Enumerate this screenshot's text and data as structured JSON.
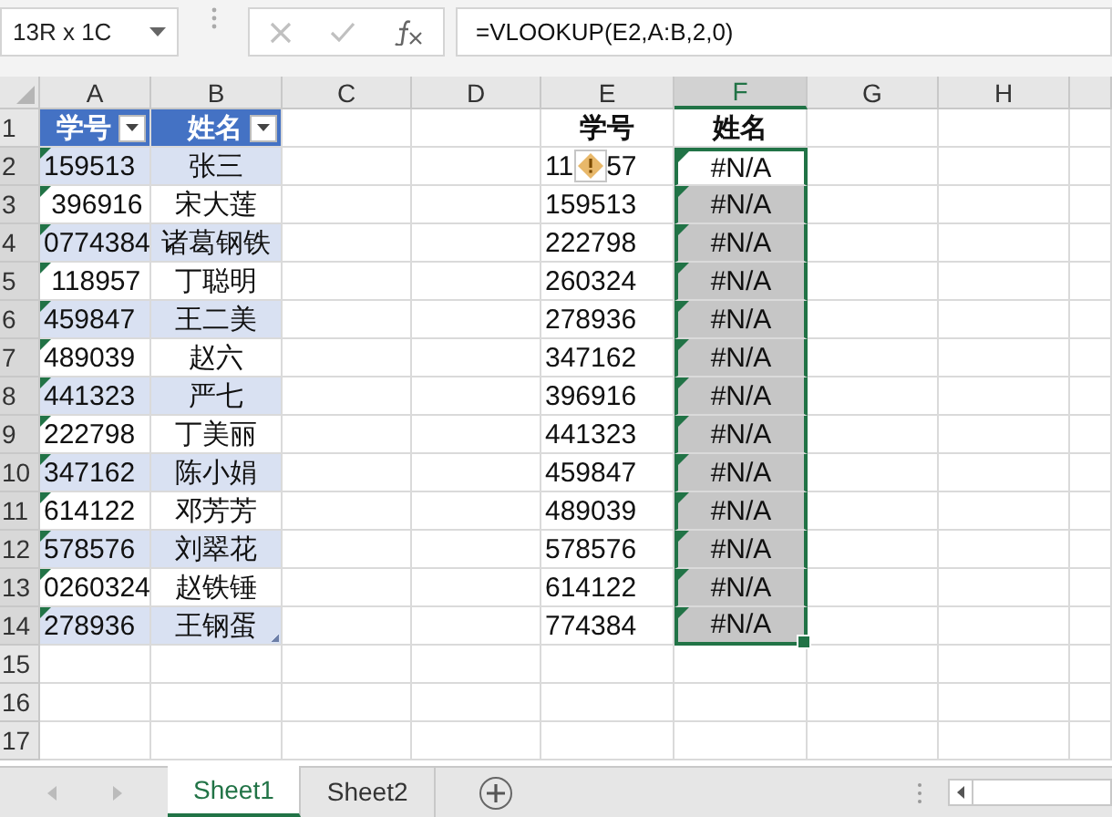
{
  "name_box": "13R x 1C",
  "formula": "=VLOOKUP(E2,A:B,2,0)",
  "columns": [
    {
      "label": "A",
      "selected": false
    },
    {
      "label": "B",
      "selected": false
    },
    {
      "label": "C",
      "selected": false
    },
    {
      "label": "D",
      "selected": false
    },
    {
      "label": "E",
      "selected": false
    },
    {
      "label": "F",
      "selected": true
    },
    {
      "label": "G",
      "selected": false
    },
    {
      "label": "H",
      "selected": false
    }
  ],
  "rows": [
    {
      "number": "1",
      "selected": false,
      "a": {
        "text": "学号",
        "kind": "header",
        "filter": true
      },
      "b": {
        "text": "姓名",
        "kind": "header",
        "filter": true
      },
      "e": {
        "text": "学号",
        "kind": "bold"
      },
      "f": {
        "text": "姓名",
        "kind": "bold"
      }
    },
    {
      "number": "2",
      "selected": true,
      "a": {
        "text": "159513",
        "kind": "band",
        "flag": true
      },
      "b": {
        "text": "张三",
        "kind": "band"
      },
      "e": {
        "text": "11",
        "tail": "57",
        "kind": "plain",
        "warning": true
      },
      "f": {
        "text": "#N/A",
        "kind": "active",
        "flag": true
      }
    },
    {
      "number": "3",
      "selected": true,
      "a": {
        "text": " 396916",
        "kind": "plain",
        "flag": true
      },
      "b": {
        "text": "宋大莲",
        "kind": "plain"
      },
      "e": {
        "text": "159513",
        "kind": "plain"
      },
      "f": {
        "text": "#N/A",
        "kind": "selected",
        "flag": true
      }
    },
    {
      "number": "4",
      "selected": true,
      "a": {
        "text": "0774384",
        "kind": "band",
        "flag": true
      },
      "b": {
        "text": "诸葛钢铁",
        "kind": "band"
      },
      "e": {
        "text": "222798",
        "kind": "plain"
      },
      "f": {
        "text": "#N/A",
        "kind": "selected",
        "flag": true
      }
    },
    {
      "number": "5",
      "selected": true,
      "a": {
        "text": " 118957",
        "kind": "plain",
        "flag": true
      },
      "b": {
        "text": "丁聪明",
        "kind": "plain"
      },
      "e": {
        "text": "260324",
        "kind": "plain"
      },
      "f": {
        "text": "#N/A",
        "kind": "selected",
        "flag": true
      }
    },
    {
      "number": "6",
      "selected": true,
      "a": {
        "text": "459847",
        "kind": "band",
        "flag": true
      },
      "b": {
        "text": "王二美",
        "kind": "band"
      },
      "e": {
        "text": "278936",
        "kind": "plain"
      },
      "f": {
        "text": "#N/A",
        "kind": "selected",
        "flag": true
      }
    },
    {
      "number": "7",
      "selected": true,
      "a": {
        "text": "489039",
        "kind": "plain",
        "flag": true
      },
      "b": {
        "text": "赵六",
        "kind": "plain"
      },
      "e": {
        "text": "347162",
        "kind": "plain"
      },
      "f": {
        "text": "#N/A",
        "kind": "selected",
        "flag": true
      }
    },
    {
      "number": "8",
      "selected": true,
      "a": {
        "text": "441323",
        "kind": "band",
        "flag": true
      },
      "b": {
        "text": "严七",
        "kind": "band"
      },
      "e": {
        "text": "396916",
        "kind": "plain"
      },
      "f": {
        "text": "#N/A",
        "kind": "selected",
        "flag": true
      }
    },
    {
      "number": "9",
      "selected": true,
      "a": {
        "text": "222798",
        "kind": "plain",
        "flag": true
      },
      "b": {
        "text": "丁美丽",
        "kind": "plain"
      },
      "e": {
        "text": "441323",
        "kind": "plain"
      },
      "f": {
        "text": "#N/A",
        "kind": "selected",
        "flag": true
      }
    },
    {
      "number": "10",
      "selected": true,
      "a": {
        "text": "347162",
        "kind": "band",
        "flag": true
      },
      "b": {
        "text": "陈小娟",
        "kind": "band"
      },
      "e": {
        "text": "459847",
        "kind": "plain"
      },
      "f": {
        "text": "#N/A",
        "kind": "selected",
        "flag": true
      }
    },
    {
      "number": "11",
      "selected": true,
      "a": {
        "text": "614122",
        "kind": "plain",
        "flag": true
      },
      "b": {
        "text": "邓芳芳",
        "kind": "plain"
      },
      "e": {
        "text": "489039",
        "kind": "plain"
      },
      "f": {
        "text": "#N/A",
        "kind": "selected",
        "flag": true
      }
    },
    {
      "number": "12",
      "selected": true,
      "a": {
        "text": "578576",
        "kind": "band",
        "flag": true
      },
      "b": {
        "text": "刘翠花",
        "kind": "band"
      },
      "e": {
        "text": "578576",
        "kind": "plain"
      },
      "f": {
        "text": "#N/A",
        "kind": "selected",
        "flag": true
      }
    },
    {
      "number": "13",
      "selected": true,
      "a": {
        "text": "0260324",
        "kind": "plain",
        "flag": true
      },
      "b": {
        "text": "赵铁锤",
        "kind": "plain"
      },
      "e": {
        "text": "614122",
        "kind": "plain"
      },
      "f": {
        "text": "#N/A",
        "kind": "selected",
        "flag": true
      }
    },
    {
      "number": "14",
      "selected": true,
      "a": {
        "text": "278936",
        "kind": "band",
        "flag": true
      },
      "b": {
        "text": "王钢蛋",
        "kind": "band",
        "table_end": true
      },
      "e": {
        "text": "774384",
        "kind": "plain"
      },
      "f": {
        "text": "#N/A",
        "kind": "selected",
        "flag": true
      }
    },
    {
      "number": "15",
      "selected": false
    },
    {
      "number": "16",
      "selected": false
    },
    {
      "number": "17",
      "selected": false
    }
  ],
  "sheets": [
    {
      "label": "Sheet1",
      "selected": true
    },
    {
      "label": "Sheet2",
      "selected": false
    }
  ]
}
